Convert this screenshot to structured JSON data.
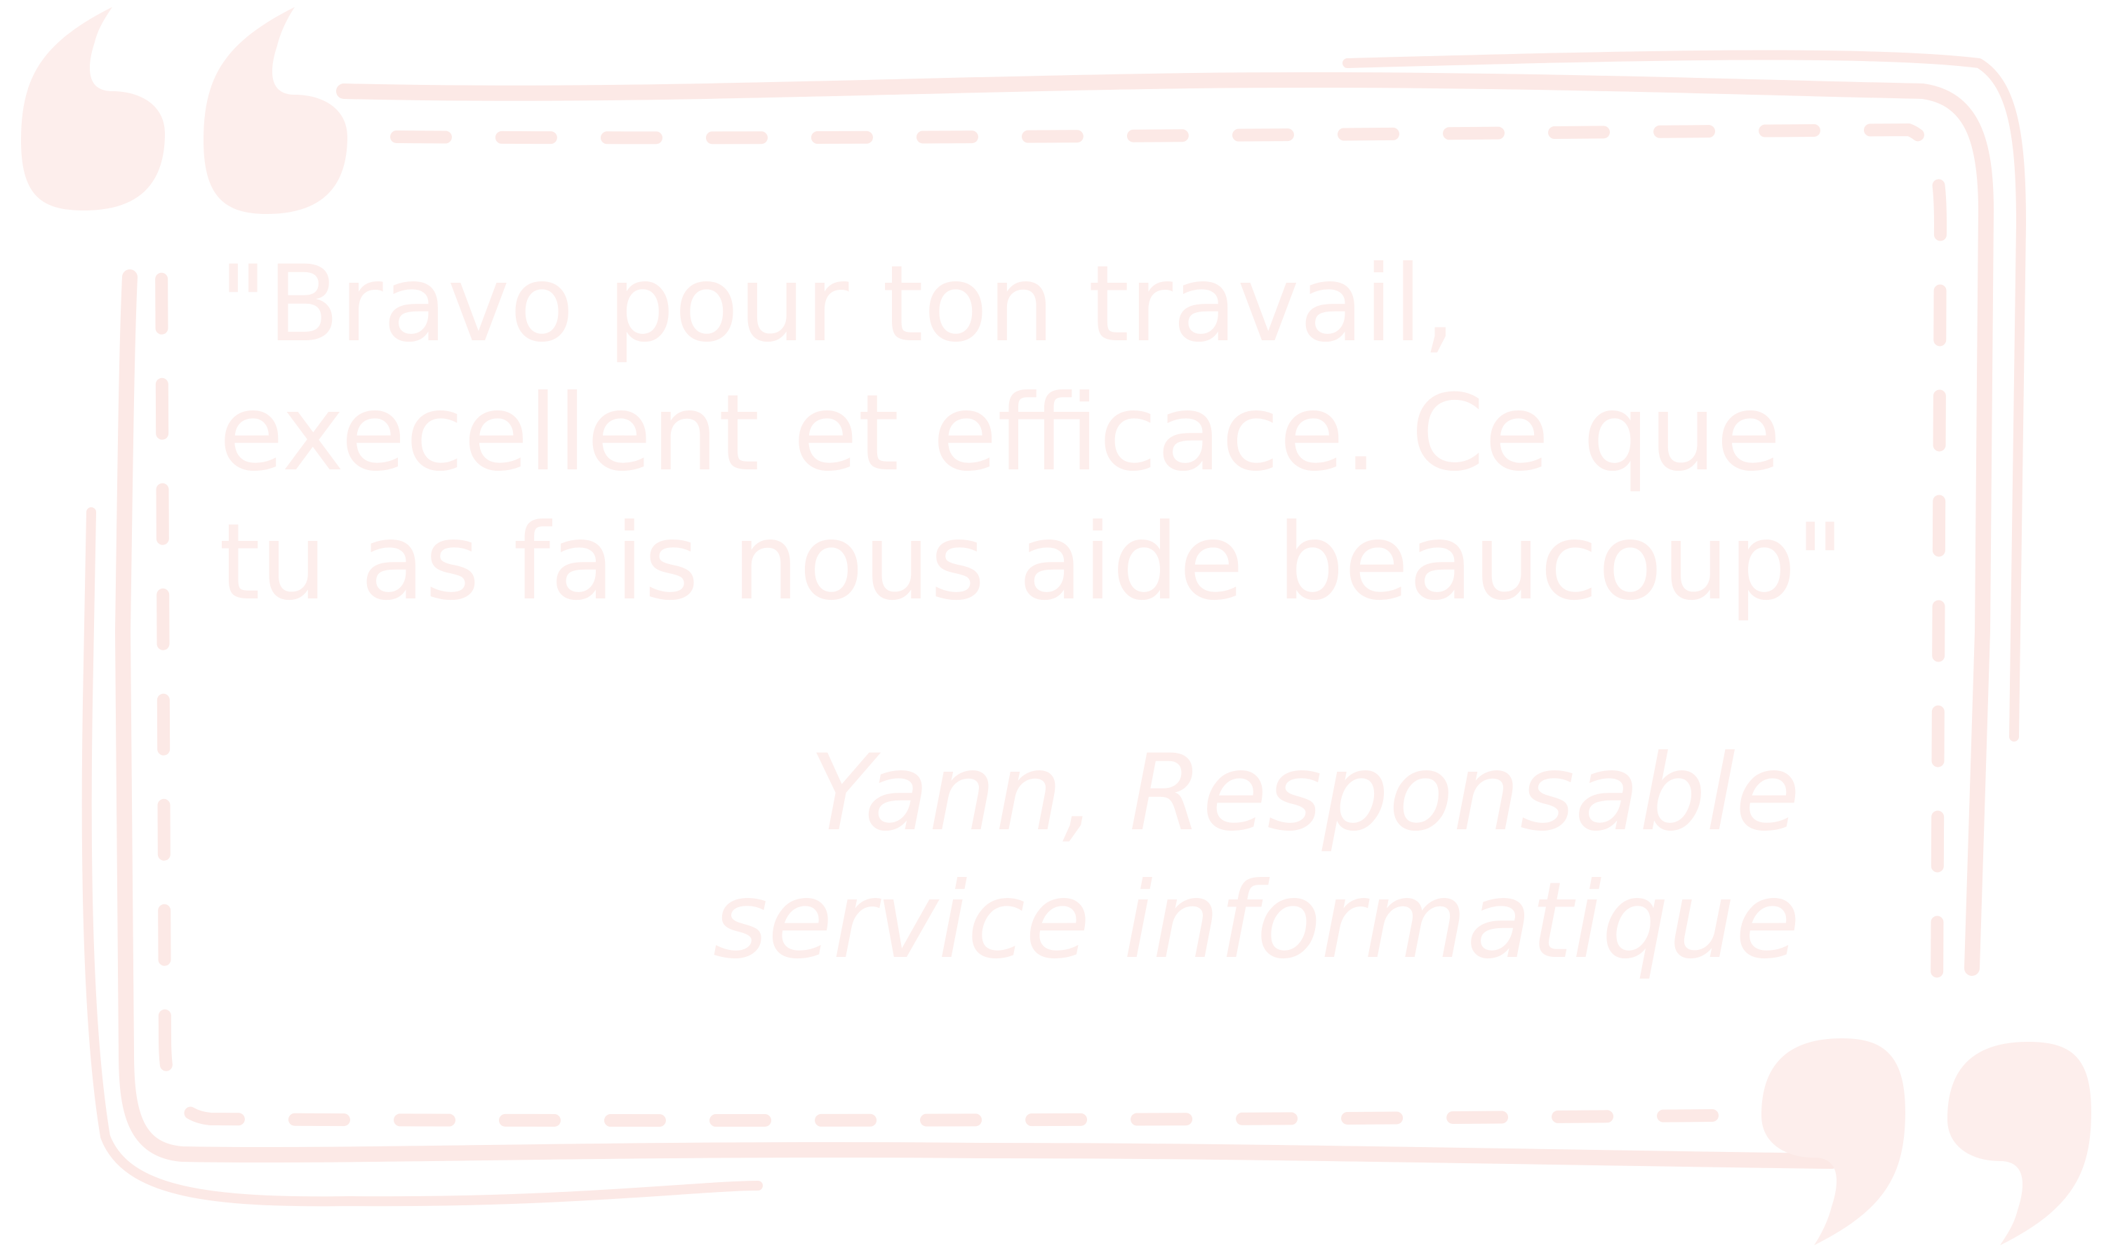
{
  "quote": {
    "lines": [
      "\"Bravo pour ton travail,",
      "execellent et efficace. Ce que",
      "tu as fais nous aide beaucoup\""
    ]
  },
  "author": {
    "line1": "Yann, Responsable",
    "line2": "service informatique"
  },
  "colors": {
    "ink": "#fdeeec",
    "frame": "#fce9e6",
    "background": "#ffffff"
  }
}
